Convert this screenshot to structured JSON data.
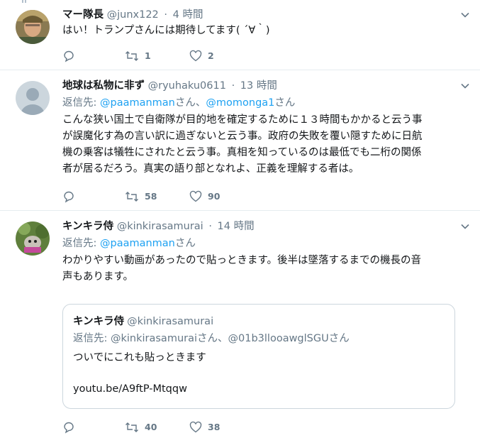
{
  "tweets": [
    {
      "display_name": "マー隊長",
      "handle": "@junx122",
      "dot": "·",
      "time": "4 時間",
      "text": "はい！トランプさんには期待してます( ´∀｀)",
      "actions": {
        "reply_count": "",
        "retweet_count": "1",
        "like_count": "2"
      }
    },
    {
      "display_name": "地球は私物に非ず",
      "handle": "@ryuhaku0611",
      "dot": "·",
      "time": "13 時間",
      "reply_prefix": "返信先: ",
      "reply_user1": "@paamanman",
      "reply_sep": "さん、",
      "reply_user2": "@momonga1",
      "reply_suffix": "さん",
      "text_lines": [
        "こんな狭い国土で自衛隊が目的地を確定するために１３時間もかかると云う事",
        "が誤魔化す為の言い訳に過ぎないと云う事。政府の失敗を覆い隠すために日航",
        "機の乗客は犠牲にされたと云う事。真相を知っているのは最低でも二桁の関係",
        "者が居るだろう。真実の語り部となれよ、正義を理解する者は。"
      ],
      "actions": {
        "reply_count": "",
        "retweet_count": "58",
        "like_count": "90"
      }
    },
    {
      "display_name": "キンキラ侍",
      "handle": "@kinkirasamurai",
      "dot": "·",
      "time": "14 時間",
      "reply_prefix": "返信先: ",
      "reply_user1": "@paamanman",
      "reply_suffix": "さん",
      "text_lines": [
        "わかりやすい動画があったので貼っときます。後半は墜落するまでの機長の音",
        "声もあります。"
      ],
      "quote": {
        "display_name": "キンキラ侍",
        "handle": "@kinkirasamurai",
        "reply_line": "返信先: @kinkirasamuraiさん、@01b3llooawglSGUさん",
        "text": "ついでにこれも貼っときます",
        "link": "youtu.be/A9ftP-Mtqqw"
      },
      "actions": {
        "reply_count": "",
        "retweet_count": "40",
        "like_count": "38"
      }
    }
  ],
  "icons": [
    "chevron-down-icon",
    "reply-icon",
    "retweet-icon",
    "like-icon"
  ],
  "colors": {
    "link": "#1da1f2",
    "secondary": "#657786",
    "border": "#e6ecf0"
  }
}
